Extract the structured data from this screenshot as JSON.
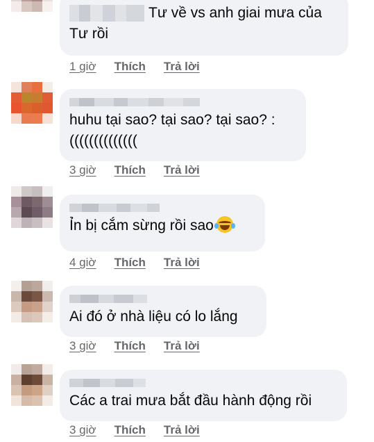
{
  "comments": [
    {
      "text": "Tư về vs anh giai mưa của\nTư rồi",
      "time": "1 giờ",
      "like": "Thích",
      "reply": "Trả lời"
    },
    {
      "text": "huhu tại sao? tại sao? tại sao? :\n((((((((((((((",
      "time": "3 giờ",
      "like": "Thích",
      "reply": "Trả lời"
    },
    {
      "text": "Ỉn bị cắm sừng rồi sao",
      "time": "4 giờ",
      "like": "Thích",
      "reply": "Trả lời",
      "emoji": "laugh-cry-emoji"
    },
    {
      "text": "Ai đó ở nhà liệu có lo lắng",
      "time": "3 giờ",
      "like": "Thích",
      "reply": "Trả lời"
    },
    {
      "text": "Các a trai mưa bắt đầu hành động rồi",
      "time": "3 giờ",
      "like": "Thích",
      "reply": "Trả lời"
    }
  ],
  "colors": {
    "bubble": "#f0f2f5",
    "meta": "#65676b",
    "text": "#050505"
  }
}
